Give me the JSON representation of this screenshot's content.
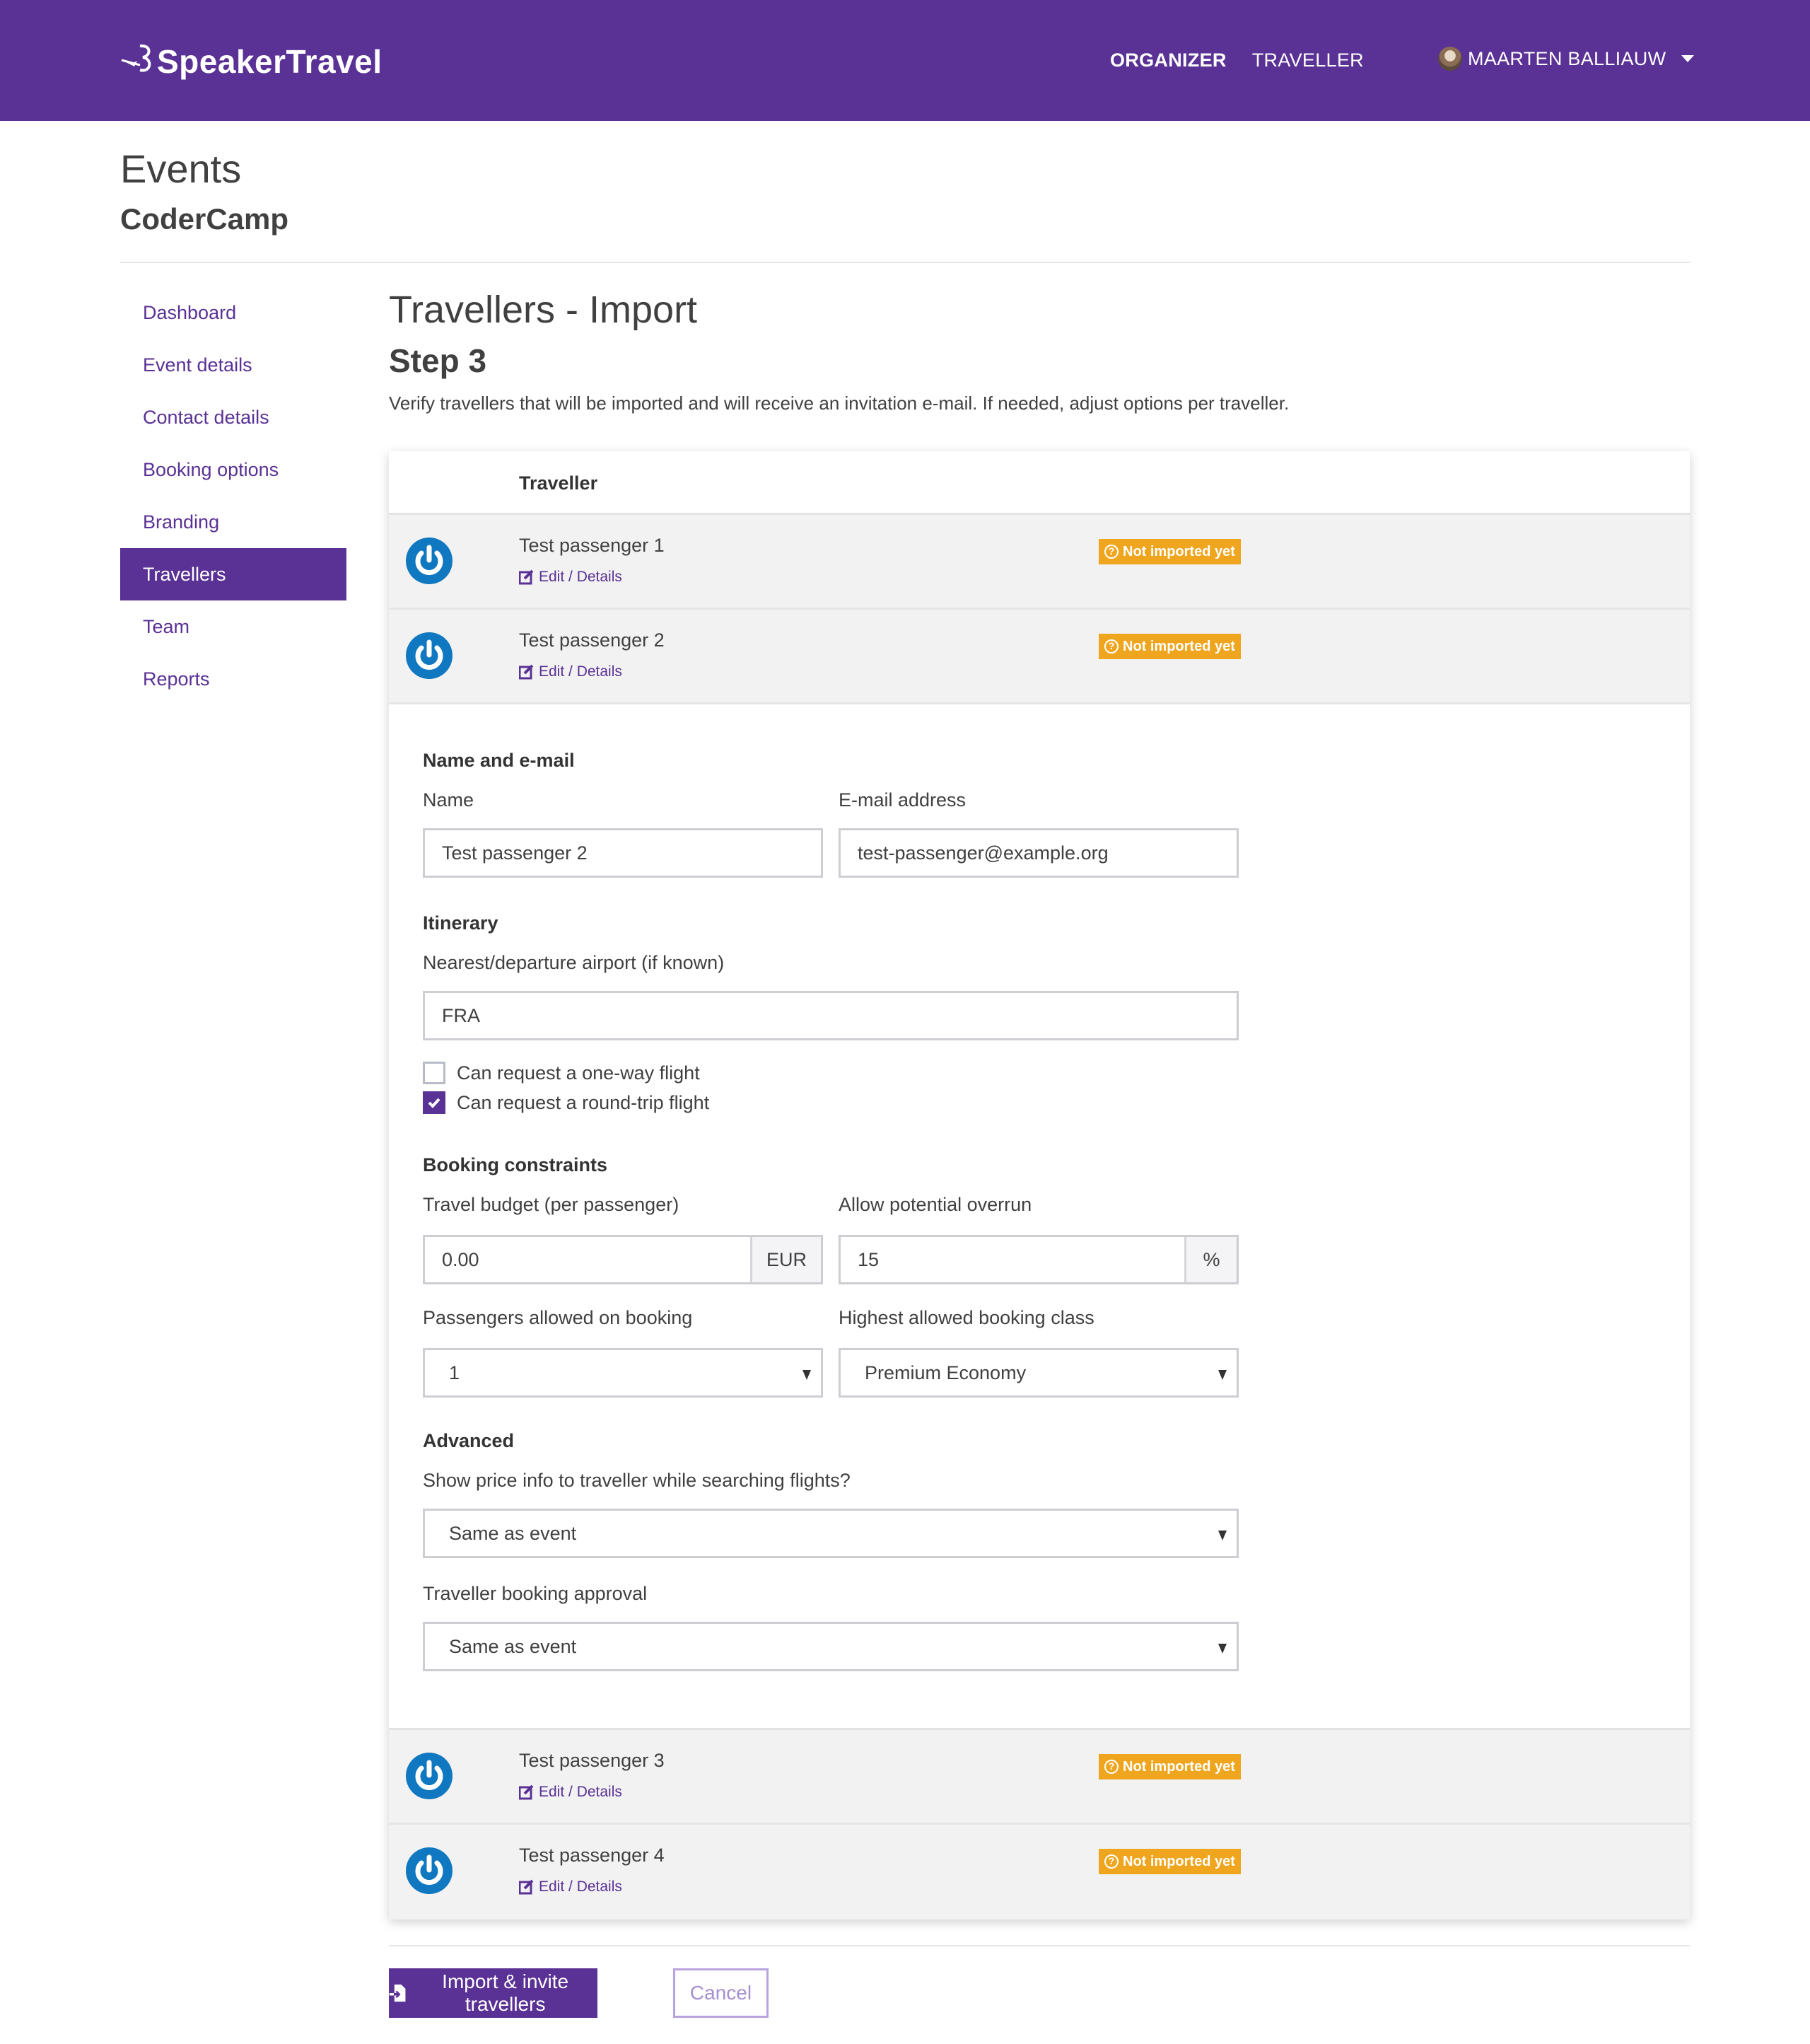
{
  "navbar": {
    "brand": "SpeakerTravel",
    "links": [
      {
        "label": "ORGANIZER",
        "active": true
      },
      {
        "label": "TRAVELLER",
        "active": false
      }
    ],
    "user": {
      "name": "MAARTEN BALLIAUW"
    }
  },
  "header": {
    "title": "Events",
    "subtitle": "CoderCamp"
  },
  "sidebar": {
    "items": [
      {
        "label": "Dashboard",
        "active": false
      },
      {
        "label": "Event details",
        "active": false
      },
      {
        "label": "Contact details",
        "active": false
      },
      {
        "label": "Booking options",
        "active": false
      },
      {
        "label": "Branding",
        "active": false
      },
      {
        "label": "Travellers",
        "active": true
      },
      {
        "label": "Team",
        "active": false
      },
      {
        "label": "Reports",
        "active": false
      }
    ]
  },
  "main": {
    "title": "Travellers - Import",
    "step": "Step 3",
    "intro": "Verify travellers that will be imported and will receive an invitation e-mail. If needed, adjust options per traveller.",
    "table": {
      "column_header": "Traveller",
      "edit_label": "Edit / Details",
      "rows": [
        {
          "name": "Test passenger 1",
          "status": "Not imported yet"
        },
        {
          "name": "Test passenger 2",
          "status": "Not imported yet"
        },
        {
          "name": "Test passenger 3",
          "status": "Not imported yet"
        },
        {
          "name": "Test passenger 4",
          "status": "Not imported yet"
        }
      ]
    },
    "form": {
      "name_section": "Name and e-mail",
      "name_label": "Name",
      "name_value": "Test passenger 2",
      "email_label": "E-mail address",
      "email_value": "test-passenger@example.org",
      "itinerary_section": "Itinerary",
      "airport_label": "Nearest/departure airport (if known)",
      "airport_value": "FRA",
      "one_way_label": "Can request a one-way flight",
      "one_way_checked": false,
      "round_trip_label": "Can request a round-trip flight",
      "round_trip_checked": true,
      "constraints_section": "Booking constraints",
      "budget_label": "Travel budget (per passenger)",
      "budget_value": "0.00",
      "budget_currency": "EUR",
      "overrun_label": "Allow potential overrun",
      "overrun_value": "15",
      "overrun_unit": "%",
      "passengers_label": "Passengers allowed on booking",
      "passengers_value": "1",
      "class_label": "Highest allowed booking class",
      "class_value": "Premium Economy",
      "advanced_section": "Advanced",
      "price_info_label": "Show price info to traveller while searching flights?",
      "price_info_value": "Same as event",
      "approval_label": "Traveller booking approval",
      "approval_value": "Same as event"
    },
    "actions": {
      "import_label": "Import & invite travellers",
      "cancel_label": "Cancel"
    }
  },
  "colors": {
    "brand_purple": "#5a3195",
    "badge_orange": "#efa51e",
    "logo_blue": "#0f78c0"
  }
}
